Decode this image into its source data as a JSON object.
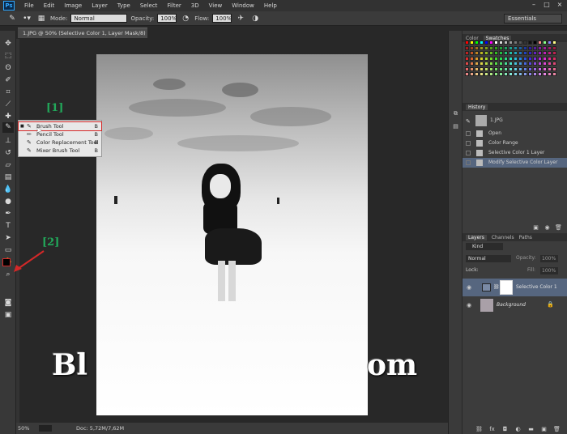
{
  "menubar": {
    "logo": "Ps",
    "items": [
      "File",
      "Edit",
      "Image",
      "Layer",
      "Type",
      "Select",
      "Filter",
      "3D",
      "View",
      "Window",
      "Help"
    ]
  },
  "options": {
    "mode_label": "Mode:",
    "mode_value": "Normal",
    "opacity_label": "Opacity:",
    "opacity_value": "100%",
    "flow_label": "Flow:",
    "flow_value": "100%",
    "workspace": "Essentials"
  },
  "document": {
    "tab_title": "1.JPG @ 50% (Selective Color 1, Layer Mask/8) *",
    "zoom": "50%",
    "doc_info": "Doc: 5,72M/7,62M"
  },
  "flyout": {
    "items": [
      {
        "label": "Brush Tool",
        "key": "B"
      },
      {
        "label": "Pencil Tool",
        "key": "B"
      },
      {
        "label": "Color Replacement Tool",
        "key": "B"
      },
      {
        "label": "Mixer Brush Tool",
        "key": "B"
      }
    ]
  },
  "annotations": {
    "one": "[1]",
    "two": "[2]"
  },
  "watermark": {
    "left": "Bl",
    "right": "om"
  },
  "swatches_panel": {
    "tabs": [
      "Color",
      "Swatches"
    ]
  },
  "history": {
    "title": "History",
    "snapshot": "1.JPG",
    "states": [
      "Open",
      "Color Range",
      "Selective Color 1 Layer",
      "Modify Selective Color Layer"
    ]
  },
  "layers": {
    "tabs": [
      "Layers",
      "Channels",
      "Paths"
    ],
    "kind": "Kind",
    "blend_mode": "Normal",
    "opacity_label": "Opacity:",
    "opacity_value": "100%",
    "lock_label": "Lock:",
    "fill_label": "Fill:",
    "fill_value": "100%",
    "items": [
      "Selective Color 1",
      "Background"
    ]
  },
  "colors": {
    "accent": "#d42828",
    "annotation": "#22a85a",
    "active_layer": "#56667f"
  }
}
